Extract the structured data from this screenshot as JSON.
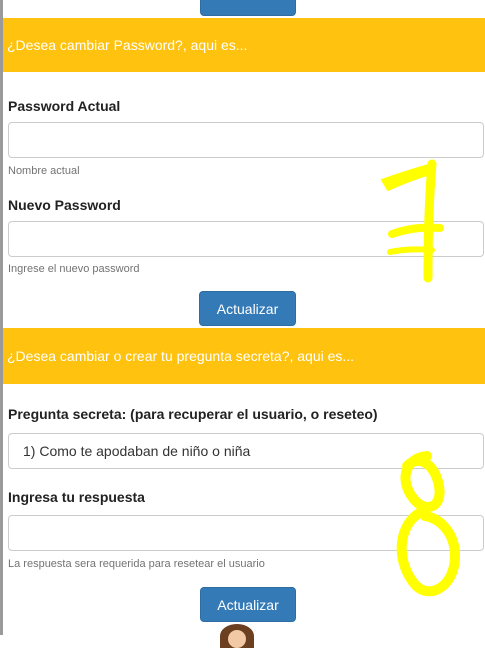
{
  "top_button": {
    "label": ""
  },
  "password_section": {
    "banner": "¿Desea cambiar Password?, aqui es...",
    "current_label": "Password Actual",
    "current_value": "",
    "current_help": "Nombre actual",
    "new_label": "Nuevo Password",
    "new_value": "",
    "new_help": "Ingrese el nuevo password",
    "submit_label": "Actualizar"
  },
  "question_section": {
    "banner": "¿Desea cambiar o crear tu pregunta secreta?, aqui es...",
    "question_label": "Pregunta secreta: (para recuperar el usuario, o reseteo)",
    "question_selected": "1) Como te apodaban de niño o niña",
    "answer_label": "Ingresa tu respuesta",
    "answer_value": "",
    "answer_help": "La respuesta sera requerida para resetear el usuario",
    "submit_label": "Actualizar"
  },
  "annotations": {
    "mark_1": "7",
    "mark_2": "8",
    "color": "#ffff00"
  },
  "colors": {
    "banner": "#ffc20e",
    "button": "#337ab7"
  }
}
